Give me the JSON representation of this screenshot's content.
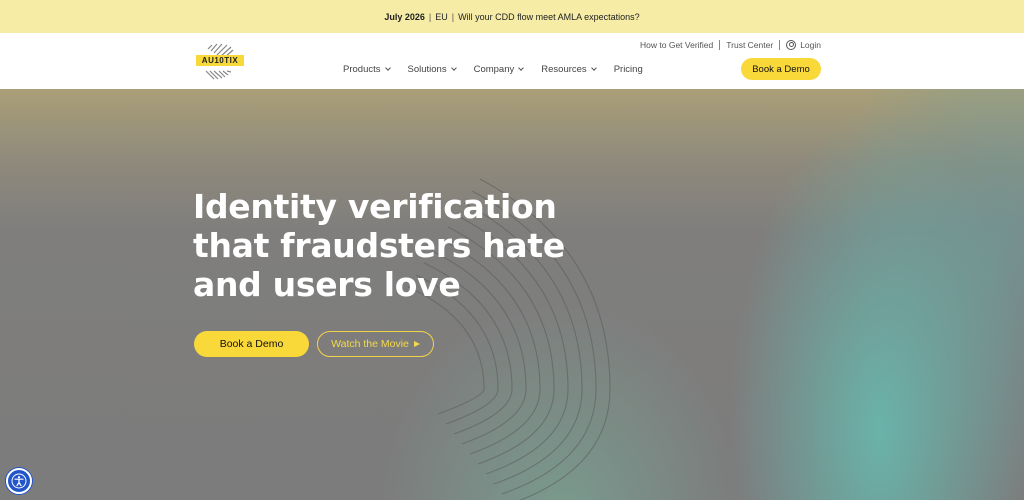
{
  "announcement": {
    "date": "July 2026",
    "region": "EU",
    "message": "Will your CDD flow meet AMLA expectations?"
  },
  "header": {
    "logo_text": "AU10TIX",
    "utility": {
      "how_to": "How to Get Verified",
      "trust": "Trust Center",
      "login": "Login"
    },
    "nav": [
      {
        "label": "Products",
        "dropdown": true
      },
      {
        "label": "Solutions",
        "dropdown": true
      },
      {
        "label": "Company",
        "dropdown": true
      },
      {
        "label": "Resources",
        "dropdown": true
      },
      {
        "label": "Pricing",
        "dropdown": false
      }
    ],
    "cta": "Book a Demo"
  },
  "hero": {
    "headline_line1": "Identity verification",
    "headline_line2": "that fraudsters hate",
    "headline_line3": "and users love",
    "primary_cta": "Book a Demo",
    "secondary_cta": "Watch the Movie"
  },
  "colors": {
    "accent": "#f9d83a",
    "announcement_bg": "#f6eca6",
    "a11y_button": "#2255c9"
  },
  "icons": {
    "accessibility": "accessibility-icon",
    "user": "user-icon",
    "play": "play-icon",
    "chevron": "chevron-down-icon"
  }
}
